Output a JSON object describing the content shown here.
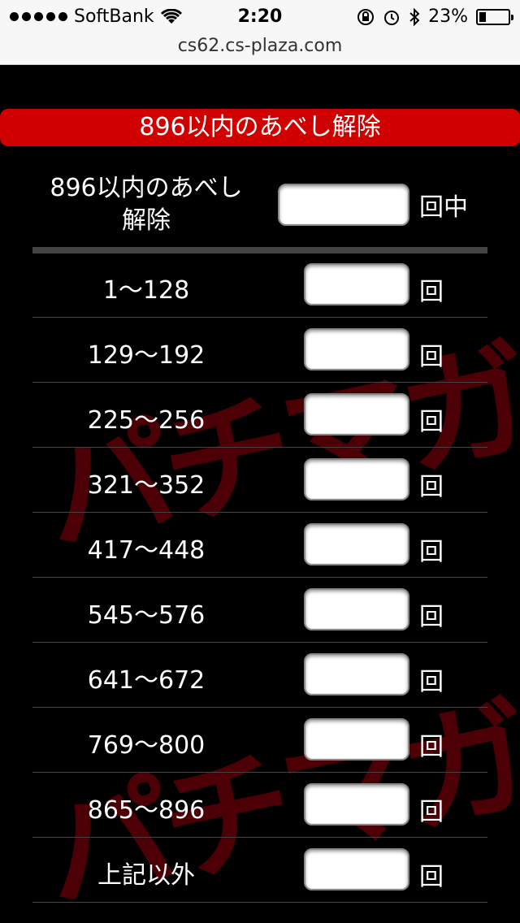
{
  "status": {
    "carrier": "SoftBank",
    "time": "2:20",
    "battery": "23%",
    "battery_level": 0.23
  },
  "url": "cs62.cs-plaza.com",
  "header": {
    "title": "896以内のあべし解除"
  },
  "summary": {
    "label": "896以内のあべし\n解除",
    "unit": "回中"
  },
  "rows": [
    {
      "label": "1〜128",
      "unit": "回"
    },
    {
      "label": "129〜192",
      "unit": "回"
    },
    {
      "label": "225〜256",
      "unit": "回"
    },
    {
      "label": "321〜352",
      "unit": "回"
    },
    {
      "label": "417〜448",
      "unit": "回"
    },
    {
      "label": "545〜576",
      "unit": "回"
    },
    {
      "label": "641〜672",
      "unit": "回"
    },
    {
      "label": "769〜800",
      "unit": "回"
    },
    {
      "label": "865〜896",
      "unit": "回"
    },
    {
      "label": "上記以外",
      "unit": "回"
    }
  ],
  "watermark": "パチマガスロマガ",
  "colors": {
    "accent": "#d00000",
    "background": "#000000"
  }
}
